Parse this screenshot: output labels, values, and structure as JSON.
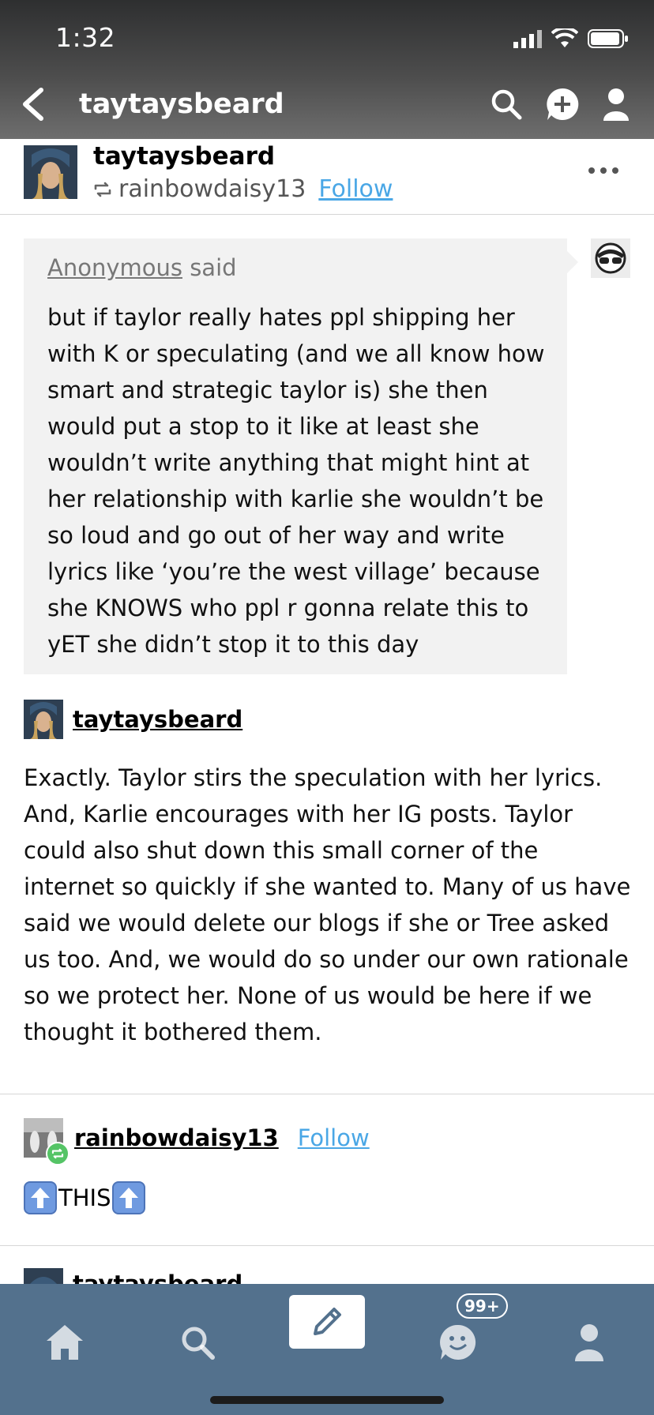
{
  "status_bar": {
    "time": "1:32"
  },
  "nav": {
    "title": "taytaysbeard"
  },
  "post": {
    "author": "taytaysbeard",
    "reblogged_from": "rainbowdaisy13",
    "follow_label": "Follow"
  },
  "ask": {
    "asker": "Anonymous",
    "said_label": "said",
    "text": "but if taylor really hates ppl shipping her with K or speculating (and we all know how smart and strategic taylor is) she then would put a stop to it like at least she wouldn’t write anything that might hint at her relationship with karlie she wouldn’t be so loud and go out of her way and write lyrics like ‘you’re the west village’ because she KNOWS who ppl r gonna relate this to yET she didn’t stop it to this day"
  },
  "answer": {
    "author": "taytaysbeard",
    "text": "Exactly. Taylor stirs the speculation with her lyrics. And, Karlie encourages with her IG posts.  Taylor could also shut down this small corner of the internet so quickly if she wanted to. Many of us have said we would delete our blogs if she or Tree asked us too. And, we would do so under our own rationale so we protect her. None of us would be here if we thought it bothered them."
  },
  "reblog": {
    "author": "rainbowdaisy13",
    "follow_label": "Follow",
    "text": "THIS"
  },
  "next_reblog": {
    "author": "taytaysbeard"
  },
  "tabbar": {
    "activity_badge": "99+"
  },
  "colors": {
    "accent": "#4aa7e6",
    "tabbar": "#53718d",
    "ask_bg": "#f2f2f2",
    "reblog_green": "#55c466"
  }
}
